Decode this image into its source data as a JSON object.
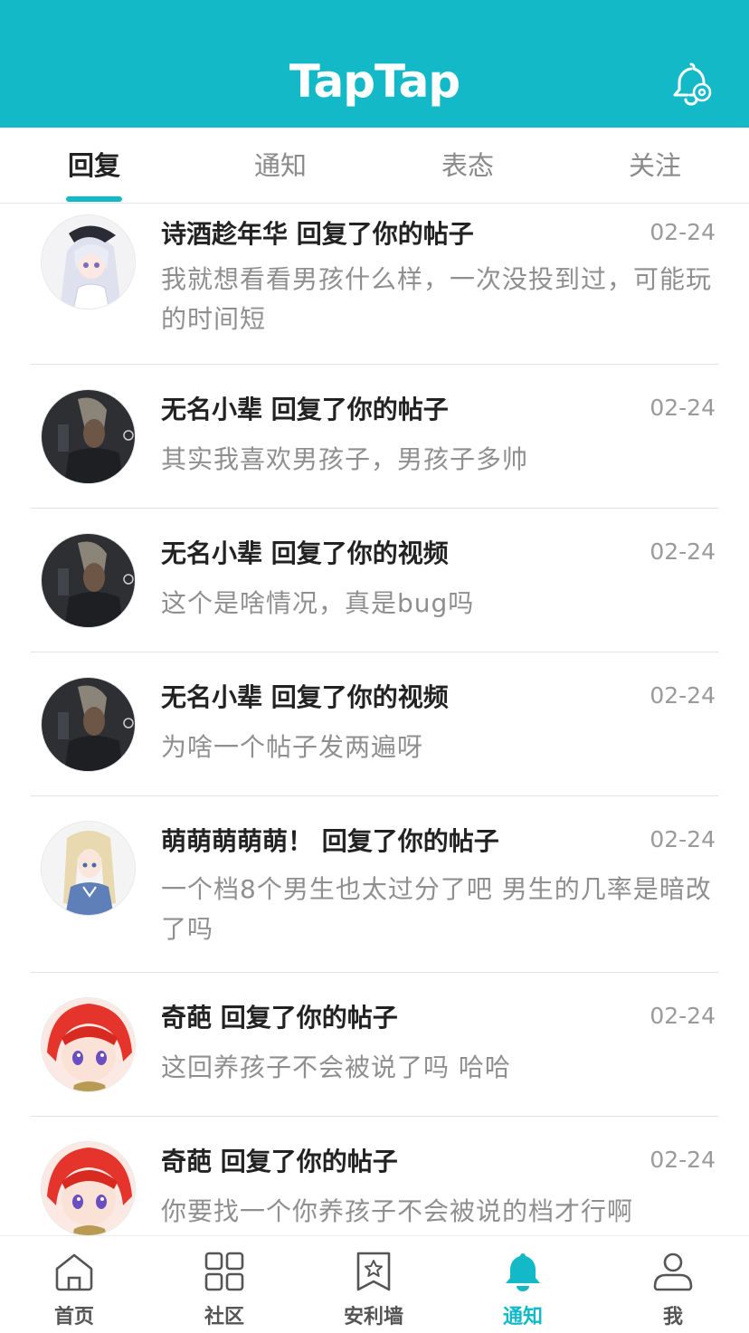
{
  "app": {
    "logo": "TapTap",
    "accent": "#14b9c8"
  },
  "header": {
    "settings_icon": "bell-gear-icon"
  },
  "tabs": [
    {
      "label": "回复",
      "active": true
    },
    {
      "label": "通知",
      "active": false
    },
    {
      "label": "表态",
      "active": false
    },
    {
      "label": "关注",
      "active": false
    }
  ],
  "notifications": [
    {
      "title": "诗酒趁年华 回复了你的帖子",
      "date": "02-24",
      "body": "我就想看看男孩什么样，一次没投到过，可能玩的时间短",
      "avatar": "white-hair-anime-girl"
    },
    {
      "title": "无名小辈 回复了你的帖子",
      "date": "02-24",
      "body": "其实我喜欢男孩子，男孩子多帅",
      "avatar": "dark-hero-portrait"
    },
    {
      "title": "无名小辈 回复了你的视频",
      "date": "02-24",
      "body": "这个是啥情况，真是bug吗",
      "avatar": "dark-hero-portrait"
    },
    {
      "title": "无名小辈 回复了你的视频",
      "date": "02-24",
      "body": "为啥一个帖子发两遍呀",
      "avatar": "dark-hero-portrait"
    },
    {
      "title": "萌萌萌萌萌！ 回复了你的帖子",
      "date": "02-24",
      "body": "一个档8个男生也太过分了吧  男生的几率是暗改了吗",
      "avatar": "blonde-anime-girl"
    },
    {
      "title": "奇葩 回复了你的帖子",
      "date": "02-24",
      "body": "这回养孩子不会被说了吗  哈哈",
      "avatar": "red-hair-chibi"
    },
    {
      "title": "奇葩 回复了你的帖子",
      "date": "02-24",
      "body": "你要找一个你养孩子不会被说的档才行啊",
      "avatar": "red-hair-chibi"
    }
  ],
  "bottom_nav": [
    {
      "label": "首页",
      "icon": "home-icon",
      "active": false
    },
    {
      "label": "社区",
      "icon": "grid-icon",
      "active": false
    },
    {
      "label": "安利墙",
      "icon": "bookmark-star-icon",
      "active": false
    },
    {
      "label": "通知",
      "icon": "bell-icon",
      "active": true
    },
    {
      "label": "我",
      "icon": "user-icon",
      "active": false
    }
  ]
}
